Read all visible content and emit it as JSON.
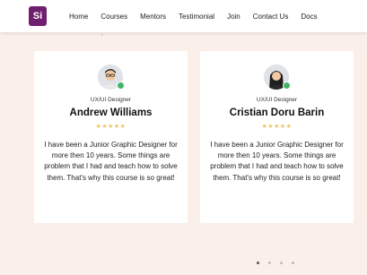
{
  "nav": {
    "logo_text": "Si",
    "links": [
      "Home",
      "Courses",
      "Mentors",
      "Testimonial",
      "Join",
      "Contact Us",
      "Docs"
    ]
  },
  "cards": [
    {
      "role": "UX/UI Designer",
      "name": "Andrew Williams",
      "stars": "★★★★★",
      "quote": "I have been a Junior Graphic Designer for more then 10 years. Some things are problem that I had and teach how to solve them. That's why this course is so great!"
    },
    {
      "role": "UX/UI Designer",
      "name": "Cristian Doru Barin",
      "stars": "★★★★★",
      "quote": "I have been a Junior Graphic Designer for more then 10 years. Some things are problem that I had and teach how to solve them. That's why this course is so great!"
    }
  ],
  "pagination": {
    "count": 4,
    "active_index": 0
  },
  "colors": {
    "brand": "#6f1f6e",
    "background": "#fbf0e9",
    "online_status": "#3fb565",
    "star": "#f0c36b"
  }
}
